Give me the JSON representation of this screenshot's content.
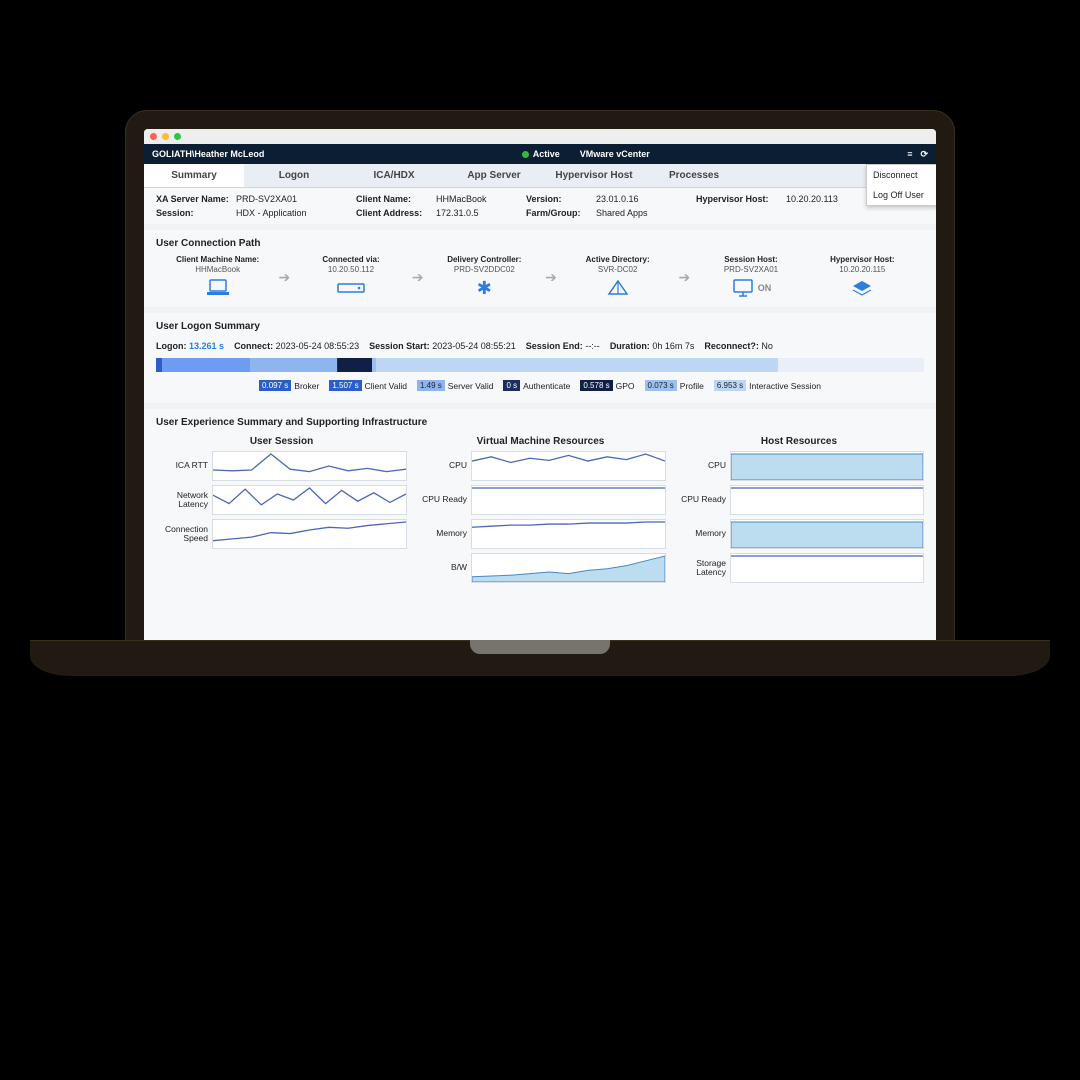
{
  "header": {
    "user": "GOLIATH\\Heather McLeod",
    "status": "Active",
    "env": "VMware vCenter"
  },
  "tabs": [
    "Summary",
    "Logon",
    "ICA/HDX",
    "App Server",
    "Hypervisor Host",
    "Processes"
  ],
  "dropdown": {
    "item1": "Disconnect",
    "item2": "Log Off User"
  },
  "info": {
    "xa_label": "XA Server Name:",
    "xa": "PRD-SV2XA01",
    "client_label": "Client Name:",
    "client": "HHMacBook",
    "ver_label": "Version:",
    "ver": "23.01.0.16",
    "hv_label": "Hypervisor Host:",
    "hv": "10.20.20.113",
    "sess_label": "Session:",
    "sess": "HDX - Application",
    "caddr_label": "Client Address:",
    "caddr": "172.31.0.5",
    "farm_label": "Farm/Group:",
    "farm": "Shared Apps"
  },
  "path_title": "User Connection Path",
  "path": {
    "client": {
      "t": "Client Machine Name:",
      "v": "HHMacBook"
    },
    "conn": {
      "t": "Connected via:",
      "v": "10.20.50.112"
    },
    "dc": {
      "t": "Delivery Controller:",
      "v": "PRD-SV2DDC02"
    },
    "ad": {
      "t": "Active Directory:",
      "v": "SVR-DC02"
    },
    "sh": {
      "t": "Session Host:",
      "v": "PRD-SV2XA01"
    },
    "on": "ON",
    "hh": {
      "t": "Hypervisor Host:",
      "v": "10.20.20.115"
    }
  },
  "logon_title": "User Logon Summary",
  "logon": {
    "logon_lbl": "Logon:",
    "logon_val": "13.261 s",
    "conn_lbl": "Connect:",
    "conn_val": "2023-05-24 08:55:23",
    "start_lbl": "Session Start:",
    "start_val": "2023-05-24 08:55:21",
    "end_lbl": "Session End:",
    "end_val": "--:--",
    "dur_lbl": "Duration:",
    "dur_val": "0h 16m 7s",
    "rec_lbl": "Reconnect?:",
    "rec_val": "No"
  },
  "legend": {
    "broker": {
      "time": "0.097 s",
      "label": "Broker",
      "color": "#2a5fc8"
    },
    "client": {
      "time": "1.507 s",
      "label": "Client Valid",
      "color": "#2a5fc8"
    },
    "server": {
      "time": "1.49 s",
      "label": "Server Valid",
      "color": "#8fb5ee"
    },
    "auth": {
      "time": "0 s",
      "label": "Authenticate",
      "color": "#1a2f60"
    },
    "gpo": {
      "time": "0.578 s",
      "label": "GPO",
      "color": "#0f1f45"
    },
    "profile": {
      "time": "0.073 s",
      "label": "Profile",
      "color": "#9cc0f0"
    },
    "inter": {
      "time": "6.953 s",
      "label": "Interactive Session",
      "color": "#bcd6f4"
    }
  },
  "ux_title": "User Experience Summary and Supporting Infrastructure",
  "ux_cols": {
    "us": {
      "title": "User Session",
      "r1": "ICA RTT",
      "r2": "Network Latency",
      "r3": "Connection Speed"
    },
    "vm": {
      "title": "Virtual Machine Resources",
      "r1": "CPU",
      "r2": "CPU Ready",
      "r3": "Memory",
      "r4": "B/W"
    },
    "host": {
      "title": "Host Resources",
      "r1": "CPU",
      "r2": "CPU Ready",
      "r3": "Memory",
      "r4": "Storage Latency"
    }
  },
  "chart_data": [
    {
      "type": "line",
      "name": "ica_rtt",
      "values": [
        20,
        18,
        20,
        60,
        22,
        16,
        30,
        18,
        24,
        16,
        22
      ]
    },
    {
      "type": "line",
      "name": "net_latency",
      "values": [
        28,
        14,
        38,
        12,
        30,
        20,
        40,
        14,
        36,
        18,
        32,
        16,
        30
      ]
    },
    {
      "type": "line",
      "name": "conn_speed",
      "values": [
        12,
        16,
        20,
        30,
        28,
        36,
        42,
        40,
        46,
        50,
        54
      ]
    },
    {
      "type": "line",
      "name": "vm_cpu",
      "values": [
        24,
        30,
        22,
        28,
        25,
        32,
        24,
        30,
        26,
        34,
        24
      ]
    },
    {
      "type": "line",
      "name": "vm_cpu_ready",
      "values": [
        2,
        2,
        2,
        2,
        2,
        2,
        2,
        2,
        2,
        2,
        2
      ]
    },
    {
      "type": "line",
      "name": "vm_memory",
      "values": [
        18,
        19,
        20,
        20,
        21,
        21,
        22,
        22,
        22,
        23,
        23
      ]
    },
    {
      "type": "area",
      "name": "vm_bw",
      "values": [
        4,
        5,
        6,
        8,
        10,
        8,
        12,
        14,
        18,
        24,
        30
      ]
    },
    {
      "type": "area",
      "name": "host_cpu",
      "values": [
        12,
        12,
        12,
        12,
        12,
        12,
        12,
        12,
        12,
        12,
        12
      ]
    },
    {
      "type": "line",
      "name": "host_cpu_ready",
      "values": [
        1,
        1,
        1,
        1,
        1,
        1,
        1,
        1,
        1,
        1,
        1
      ]
    },
    {
      "type": "area",
      "name": "host_memory",
      "values": [
        60,
        60,
        60,
        60,
        60,
        60,
        60,
        60,
        60,
        60,
        60
      ]
    },
    {
      "type": "line",
      "name": "host_storage",
      "values": [
        2,
        2,
        2,
        2,
        2,
        2,
        2,
        2,
        2,
        2,
        2
      ]
    }
  ]
}
